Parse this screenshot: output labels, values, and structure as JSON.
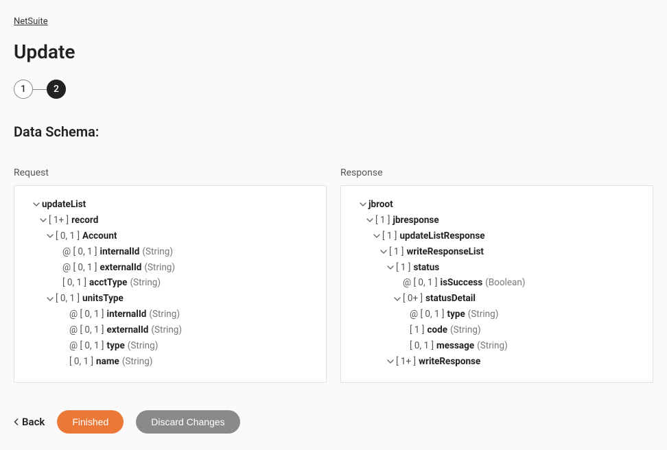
{
  "breadcrumb": "NetSuite",
  "page_title": "Update",
  "stepper": {
    "step1": "1",
    "step2": "2"
  },
  "section_title": "Data Schema:",
  "request_label": "Request",
  "response_label": "Response",
  "request_tree": [
    {
      "indent": 1,
      "chevron": true,
      "card": "",
      "name": "updateList",
      "type": ""
    },
    {
      "indent": 2,
      "chevron": true,
      "card": "[ 1+ ]",
      "name": "record",
      "type": ""
    },
    {
      "indent": 3,
      "chevron": true,
      "card": "[ 0, 1 ]",
      "name": "Account",
      "type": ""
    },
    {
      "indent": 4,
      "chevron": false,
      "card": "@ [ 0, 1 ]",
      "name": "internalId",
      "type": "(String)"
    },
    {
      "indent": 4,
      "chevron": false,
      "card": "@ [ 0, 1 ]",
      "name": "externalId",
      "type": "(String)"
    },
    {
      "indent": 4,
      "chevron": false,
      "card": "[ 0, 1 ]",
      "name": "acctType",
      "type": "(String)"
    },
    {
      "indent": 3,
      "chevron": true,
      "card": "[ 0, 1 ]",
      "name": "unitsType",
      "type": ""
    },
    {
      "indent": 5,
      "chevron": false,
      "card": "@ [ 0, 1 ]",
      "name": "internalId",
      "type": "(String)"
    },
    {
      "indent": 5,
      "chevron": false,
      "card": "@ [ 0, 1 ]",
      "name": "externalId",
      "type": "(String)"
    },
    {
      "indent": 5,
      "chevron": false,
      "card": "@ [ 0, 1 ]",
      "name": "type",
      "type": "(String)"
    },
    {
      "indent": 5,
      "chevron": false,
      "card": "[ 0, 1 ]",
      "name": "name",
      "type": "(String)"
    }
  ],
  "response_tree": [
    {
      "indent": 1,
      "chevron": true,
      "card": "",
      "name": "jbroot",
      "type": ""
    },
    {
      "indent": 2,
      "chevron": true,
      "card": "[ 1 ]",
      "name": "jbresponse",
      "type": ""
    },
    {
      "indent": 3,
      "chevron": true,
      "card": "[ 1 ]",
      "name": "updateListResponse",
      "type": ""
    },
    {
      "indent": 4,
      "chevron": true,
      "card": "[ 1 ]",
      "name": "writeResponseList",
      "type": ""
    },
    {
      "indent": 5,
      "chevron": true,
      "card": "[ 1 ]",
      "name": "status",
      "type": ""
    },
    {
      "indent": 6,
      "chevron": false,
      "card": "@ [ 0, 1 ]",
      "name": "isSuccess",
      "type": "(Boolean)"
    },
    {
      "indent": 6,
      "chevron": true,
      "card": "[ 0+ ]",
      "name": "statusDetail",
      "type": ""
    },
    {
      "indent": 7,
      "chevron": false,
      "card": "@ [ 0, 1 ]",
      "name": "type",
      "type": "(String)"
    },
    {
      "indent": 7,
      "chevron": false,
      "card": "[ 1 ]",
      "name": "code",
      "type": "(String)"
    },
    {
      "indent": 7,
      "chevron": false,
      "card": "[ 0, 1 ]",
      "name": "message",
      "type": "(String)"
    },
    {
      "indent": 5,
      "chevron": true,
      "card": "[ 1+ ]",
      "name": "writeResponse",
      "type": ""
    }
  ],
  "footer": {
    "back": "Back",
    "finished": "Finished",
    "discard": "Discard Changes"
  }
}
